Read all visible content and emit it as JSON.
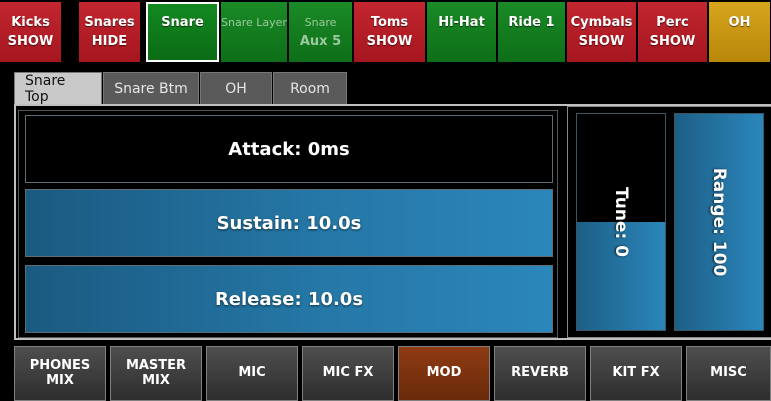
{
  "channels": [
    {
      "line1": "Kicks",
      "line2": "SHOW",
      "color": "red"
    },
    {
      "line1": "Snares",
      "line2": "HIDE",
      "color": "red"
    },
    {
      "line1": "Snare",
      "line2": "",
      "color": "green",
      "active": true
    },
    {
      "line1": "Snare Layer",
      "line2": "",
      "color": "green",
      "dim": true
    },
    {
      "line1": "Snare",
      "line2": "Aux 5",
      "color": "green",
      "dim": true
    },
    {
      "line1": "Toms",
      "line2": "SHOW",
      "color": "red"
    },
    {
      "line1": "Hi-Hat",
      "line2": "",
      "color": "green"
    },
    {
      "line1": "Ride 1",
      "line2": "",
      "color": "green"
    },
    {
      "line1": "Cymbals",
      "line2": "SHOW",
      "color": "red"
    },
    {
      "line1": "Perc",
      "line2": "SHOW",
      "color": "red"
    },
    {
      "line1": "OH",
      "line2": "",
      "color": "gold"
    }
  ],
  "mic_tabs": [
    {
      "label": "Snare Top",
      "selected": true
    },
    {
      "label": "Snare Btm"
    },
    {
      "label": "OH"
    },
    {
      "label": "Room"
    }
  ],
  "envelope": {
    "attack": "Attack: 0ms",
    "sustain": "Sustain: 10.0s",
    "release": "Release: 10.0s"
  },
  "sliders": {
    "tune": {
      "label": "Tune: 0",
      "level": 0.5
    },
    "range": {
      "label": "Range: 100",
      "level": 1.0
    }
  },
  "nav": [
    "PHONES\nMIX",
    "MASTER\nMIX",
    "MIC",
    "MIC FX",
    "MOD",
    "REVERB",
    "KIT FX",
    "MISC"
  ],
  "nav_active": "MOD",
  "colors": {
    "red": "#b01e27",
    "green": "#0f7a1c",
    "gold": "#c8960f",
    "blue_accent": "#2577a6",
    "active_nav": "#7a3210"
  }
}
